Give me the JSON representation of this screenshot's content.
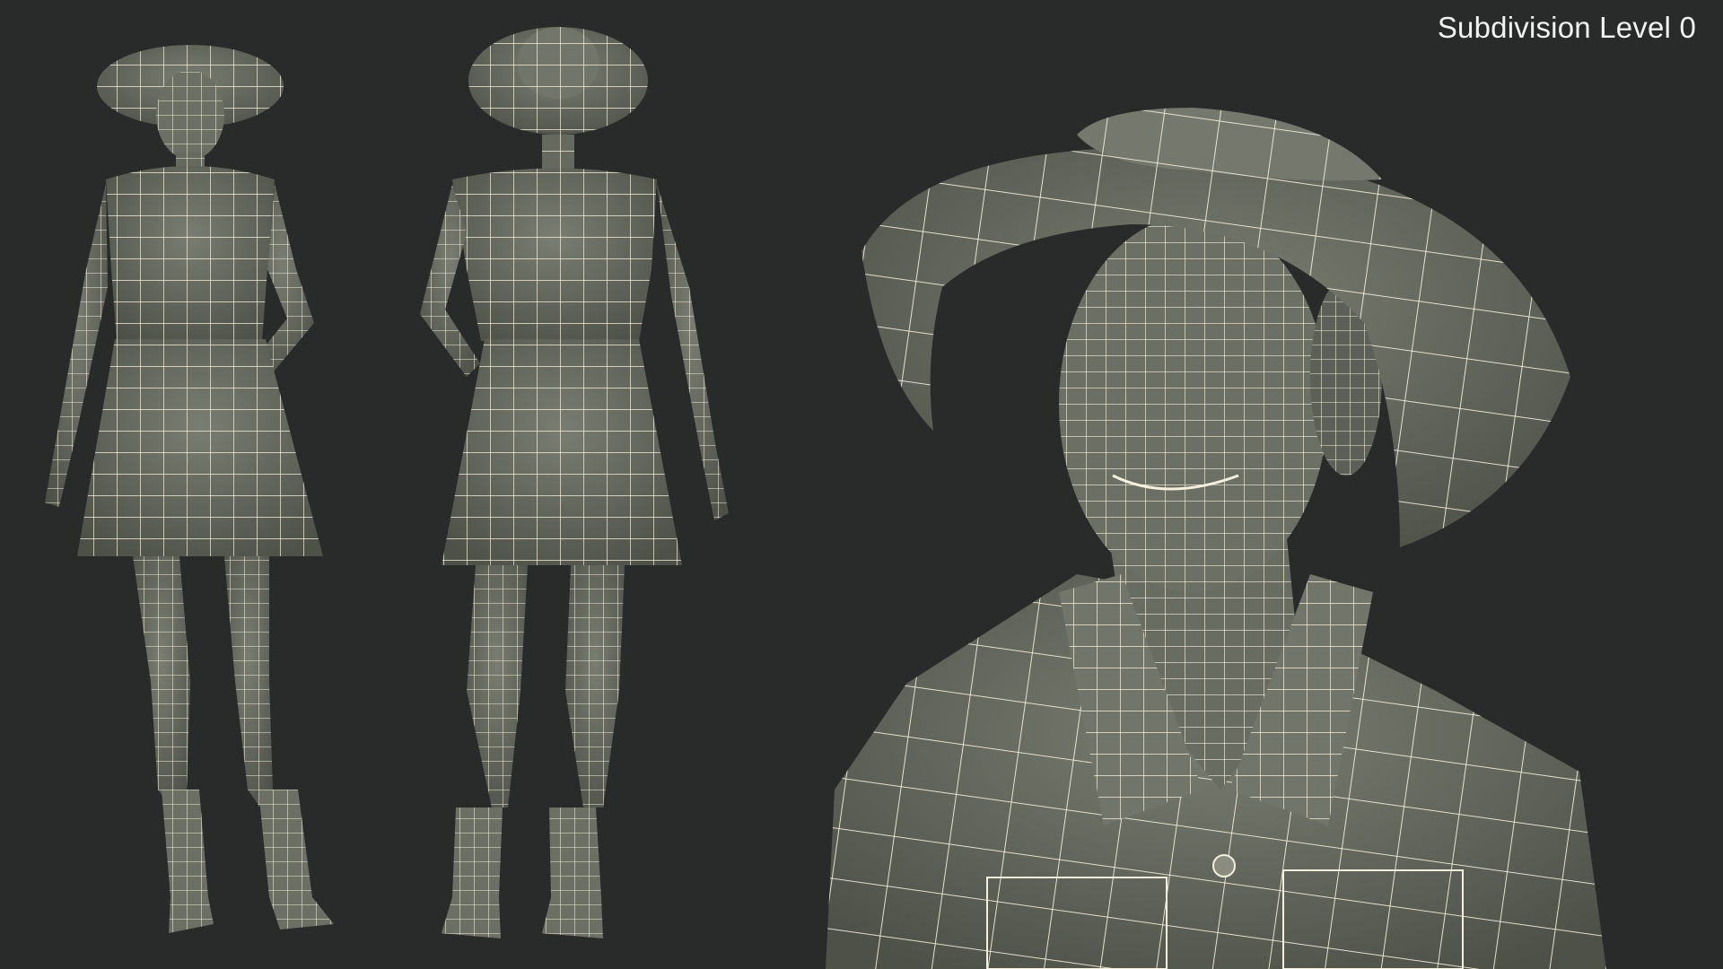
{
  "overlay": {
    "subdivision_label": "Subdivision Level 0"
  },
  "colors": {
    "background": "#292a2a",
    "mesh_fill": "#6c6f63",
    "mesh_fill_dark": "#4f5249",
    "wire": "#f4f0de"
  },
  "views": [
    {
      "name": "front"
    },
    {
      "name": "back"
    },
    {
      "name": "closeup"
    }
  ]
}
